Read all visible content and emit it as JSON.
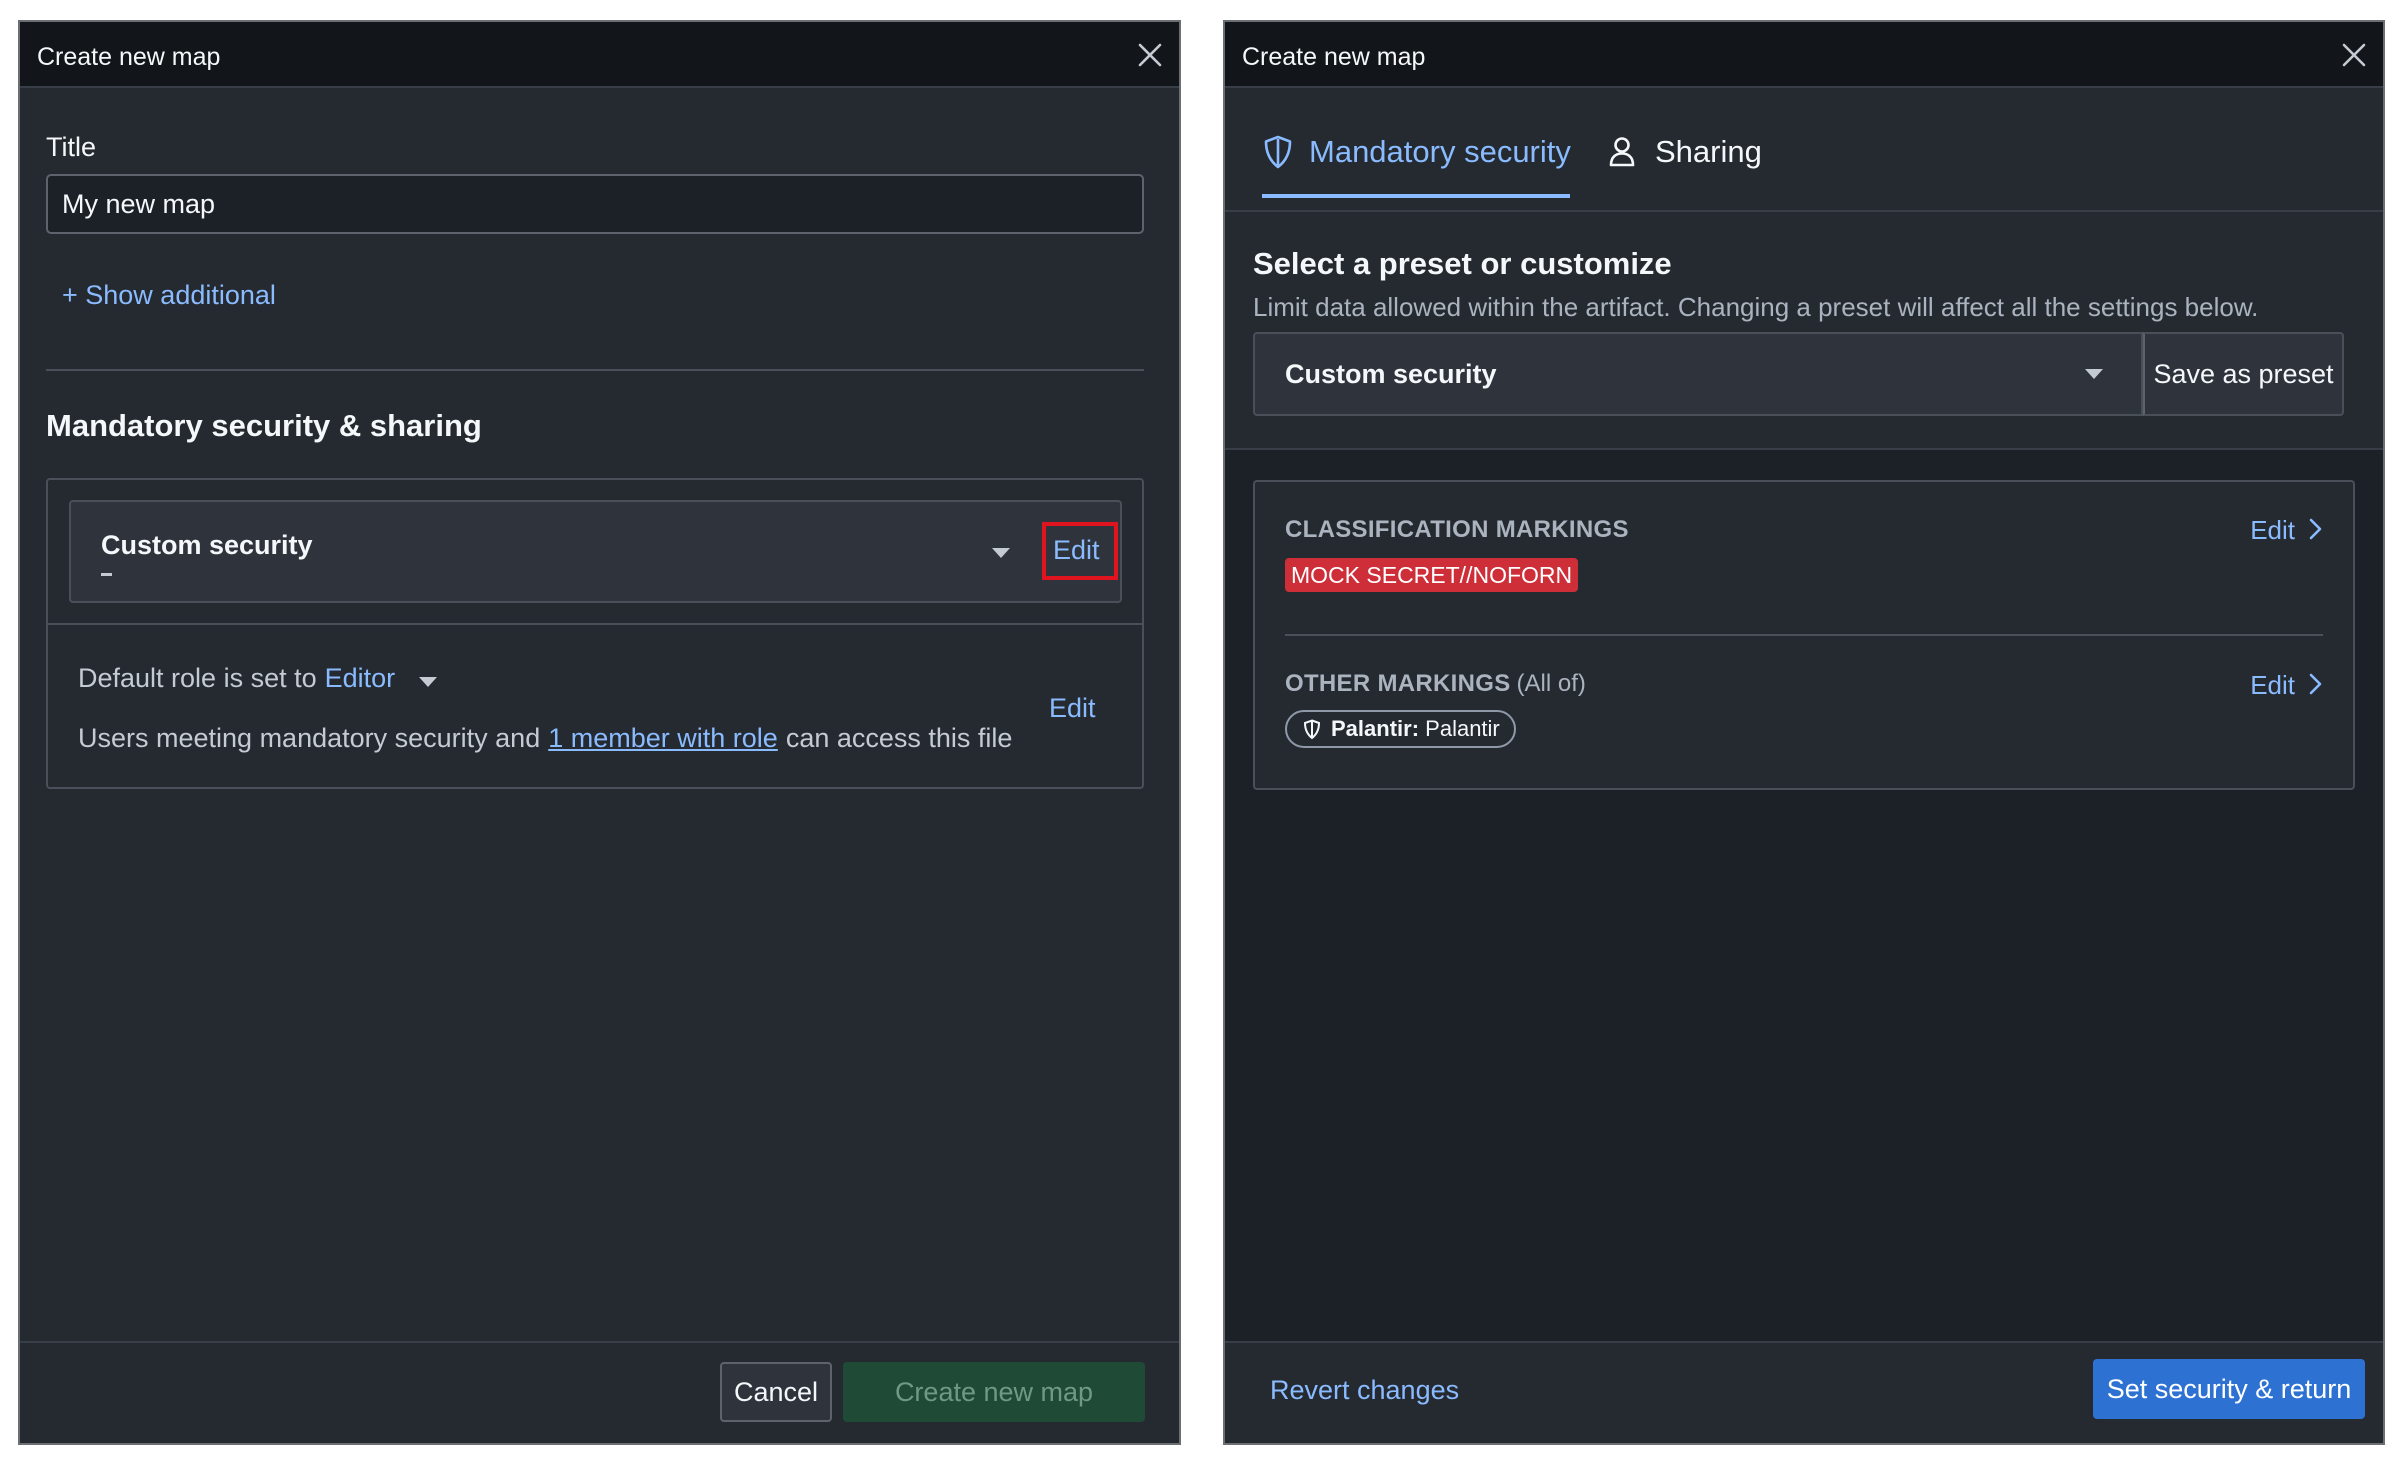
{
  "left_dialog": {
    "title": "Create new map",
    "title_field": {
      "label": "Title",
      "value": "My new map"
    },
    "show_additional": "+ Show additional",
    "section_title": "Mandatory security & sharing",
    "security_select": {
      "label": "Custom security",
      "edit_label": "Edit"
    },
    "role": {
      "prefix": "Default role is set to",
      "value": "Editor",
      "edit_label": "Edit"
    },
    "access": {
      "prefix": "Users meeting mandatory security and",
      "link": "1 member with role",
      "suffix": "can access this file"
    },
    "footer": {
      "cancel_label": "Cancel",
      "create_label": "Create new map"
    }
  },
  "right_dialog": {
    "title": "Create new map",
    "tabs": [
      {
        "label": "Mandatory security",
        "icon": "shield-icon",
        "active": true
      },
      {
        "label": "Sharing",
        "icon": "person-icon",
        "active": false
      }
    ],
    "preset": {
      "title": "Select a preset or customize",
      "subtitle": "Limit data allowed within the artifact. Changing a preset will affect all the settings below.",
      "select_label": "Custom security",
      "save_label": "Save as preset"
    },
    "classification": {
      "label": "CLASSIFICATION MARKINGS",
      "edit_label": "Edit",
      "tag": "MOCK SECRET//NOFORN"
    },
    "other": {
      "label": "OTHER MARKINGS",
      "qualifier": "(All of)",
      "edit_label": "Edit",
      "pill_bold": "Palantir:",
      "pill_text": "Palantir"
    },
    "footer": {
      "revert_label": "Revert changes",
      "submit_label": "Set security & return"
    }
  },
  "colors": {
    "dialog_bg": "#252a31",
    "header_bg": "#121519",
    "link_blue": "#8abbff",
    "primary_blue": "#2d72d2",
    "success_disabled": "#1f4b36",
    "danger_red": "#cd2e38",
    "highlight_red": "#e0141e"
  }
}
